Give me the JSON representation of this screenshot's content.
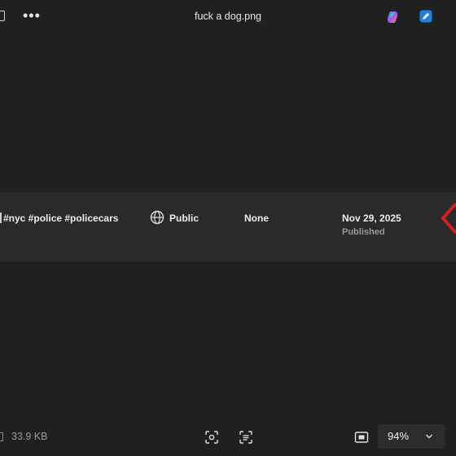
{
  "titlebar": {
    "title": "fuck a dog.png",
    "more_label": "•••",
    "icons": [
      "collection-icon",
      "more-icon",
      "copilot-icon",
      "edit-icon"
    ]
  },
  "post": {
    "tags": "#nyc #police #policecars",
    "visibility": "Public",
    "restrictions": "None",
    "date": "Nov 29, 2025",
    "status": "Published"
  },
  "bottombar": {
    "file_size": "33.9 KB",
    "zoom": "94%",
    "icons": [
      "file-icon",
      "visual-search-icon",
      "extract-text-icon",
      "fit-to-window-icon",
      "chevron-down-icon"
    ]
  },
  "colors": {
    "background": "#202020",
    "strip": "#2a2a2a",
    "accent_red": "#d21f1f"
  }
}
